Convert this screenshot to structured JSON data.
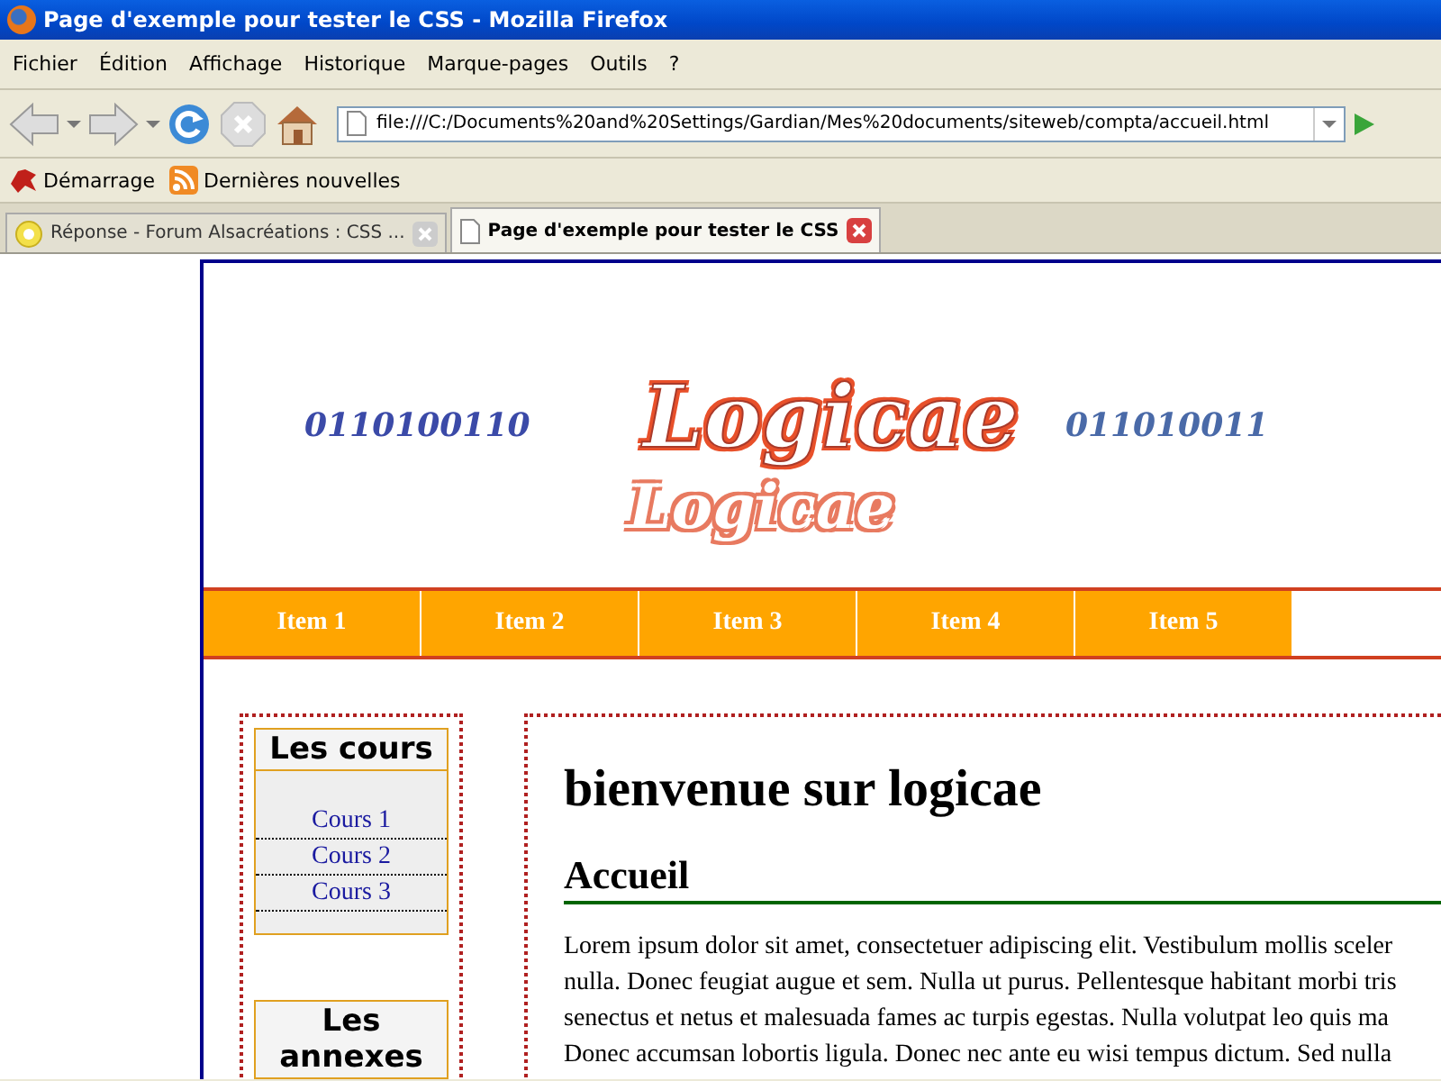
{
  "window": {
    "title": "Page d'exemple pour tester le CSS - Mozilla Firefox"
  },
  "menu": [
    "Fichier",
    "Édition",
    "Affichage",
    "Historique",
    "Marque-pages",
    "Outils",
    "?"
  ],
  "toolbar": {
    "back_disabled": true,
    "forward_disabled": true,
    "stop_disabled": true,
    "url": "file:///C:/Documents%20and%20Settings/Gardian/Mes%20documents/siteweb/compta/accueil.html"
  },
  "bookmarks": [
    {
      "kind": "site",
      "label": "Démarrage"
    },
    {
      "kind": "feed",
      "label": "Dernières nouvelles"
    }
  ],
  "tabs": [
    {
      "label": "Réponse - Forum Alsacréations : CSS ...",
      "selected": false
    },
    {
      "label": "Page d'exemple pour tester le CSS",
      "selected": true
    }
  ],
  "page": {
    "banner": {
      "left_digits": "0110100110",
      "logo": "Logicae",
      "logo_reflection": "Logicae",
      "right_digits": "011010011"
    },
    "nav": [
      "Item 1",
      "Item 2",
      "Item 3",
      "Item 4",
      "Item 5"
    ],
    "sidebar": [
      {
        "title": "Les cours",
        "links": [
          "Cours 1",
          "Cours 2",
          "Cours 3"
        ]
      },
      {
        "title": "Les annexes"
      }
    ],
    "main": {
      "title": "bienvenue sur logicae",
      "heading": "Accueil",
      "lines": [
        "Lorem ipsum dolor sit amet, consectetuer adipiscing elit. Vestibulum mollis sceler",
        "nulla. Donec feugiat augue et sem. Nulla ut purus. Pellentesque habitant morbi tris",
        "senectus et netus et malesuada fames ac turpis egestas. Nulla volutpat leo quis ma",
        "Donec accumsan lobortis ligula. Donec nec ante eu wisi tempus dictum. Sed nulla"
      ]
    }
  }
}
